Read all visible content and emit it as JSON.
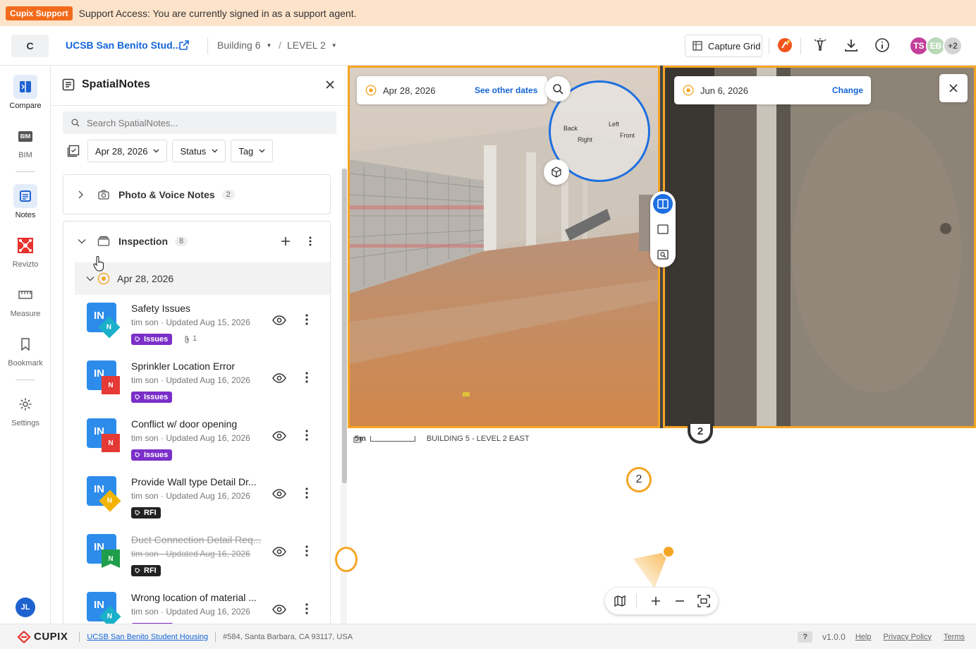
{
  "banner": {
    "badge": "Cupix Support",
    "message": "Support Access: You are currently signed in as a support agent."
  },
  "header": {
    "logo_letter": "C",
    "project_name": "UCSB San Benito Stud...",
    "breadcrumb": [
      "Building 6",
      "LEVEL 2"
    ],
    "capture_grid_label": "Capture Grid",
    "avatars": [
      {
        "initials": "TS",
        "color": "#c2409a"
      },
      {
        "initials": "EB",
        "color": "#b9d9b8"
      },
      {
        "initials": "+2",
        "color": "#d4d4d4"
      }
    ]
  },
  "nav": {
    "items": [
      {
        "label": "Compare",
        "icon": "compare-icon"
      },
      {
        "label": "BIM",
        "icon": "bim-icon"
      },
      {
        "label": "Notes",
        "icon": "notes-icon"
      },
      {
        "label": "Revizto",
        "icon": "revizto-icon"
      },
      {
        "label": "Measure",
        "icon": "ruler-icon"
      },
      {
        "label": "Bookmark",
        "icon": "bookmark-icon"
      },
      {
        "label": "Settings",
        "icon": "gear-icon"
      }
    ],
    "bim_badge": "BIM",
    "user_initials": "JL"
  },
  "panel": {
    "title": "SpatialNotes",
    "search_placeholder": "Search SpatialNotes...",
    "filters": {
      "date": "Apr 28, 2026",
      "status": "Status",
      "tag": "Tag"
    },
    "groups": [
      {
        "name": "Photo & Voice Notes",
        "count": "2"
      },
      {
        "name": "Inspection",
        "count": "8"
      }
    ],
    "date_group": "Apr 28, 2026",
    "notes": [
      {
        "title": "Safety Issues",
        "meta": "tim son · Updated Aug 15, 2026",
        "tag": "Issues",
        "tag_color": "#7b2fc9",
        "badge": "N",
        "badge_color": "#1ab0c9",
        "attachments": "1"
      },
      {
        "title": "Sprinkler Location Error",
        "meta": "tim son · Updated Aug 16, 2026",
        "tag": "Issues",
        "tag_color": "#7b2fc9",
        "badge": "N",
        "badge_color": "#e53935"
      },
      {
        "title": "Conflict w/ door opening",
        "meta": "tim son · Updated Aug 16, 2026",
        "tag": "Issues",
        "tag_color": "#7b2fc9",
        "badge": "N",
        "badge_color": "#e53935"
      },
      {
        "title": "Provide Wall type Detail Dr...",
        "meta": "tim son · Updated Aug 16, 2026",
        "tag": "RFI",
        "tag_color": "#222222",
        "badge": "N",
        "badge_color": "#f2b400"
      },
      {
        "title": "Duct Connection Detail Req...",
        "meta": "tim son · Updated Aug 16, 2026",
        "tag": "RFI",
        "tag_color": "#222222",
        "badge": "N",
        "badge_color": "#1e9e4a"
      },
      {
        "title": "Wrong location of material ...",
        "meta": "tim son · Updated Aug 16, 2026",
        "tag": "",
        "tag_color": "#7b2fc9",
        "badge": "N",
        "badge_color": "#1ab0c9"
      }
    ],
    "note_icon_text": "IN"
  },
  "viewer": {
    "left": {
      "date": "Apr 28, 2026",
      "link": "See other dates"
    },
    "right": {
      "date": "Jun 6, 2026",
      "link": "Change"
    },
    "compass": {
      "back": "Back",
      "left": "Left",
      "right": "Right",
      "front": "Front"
    }
  },
  "map": {
    "scale": "5m",
    "location": "BUILDING 5 - LEVEL 2 EAST",
    "marker_label": "2",
    "marker_top_label": "2"
  },
  "footer": {
    "brand": "CUPIX",
    "project_link": "UCSB San Benito Student Housing",
    "address": "#584, Santa Barbara, CA 93117, USA",
    "help_badge": "?",
    "version": "v1.0.0",
    "links": [
      "Help",
      "Privacy Policy",
      "Terms"
    ]
  },
  "colors": {
    "accent": "#1565d8",
    "orange": "#f5a524",
    "banner": "#fde3c9"
  }
}
